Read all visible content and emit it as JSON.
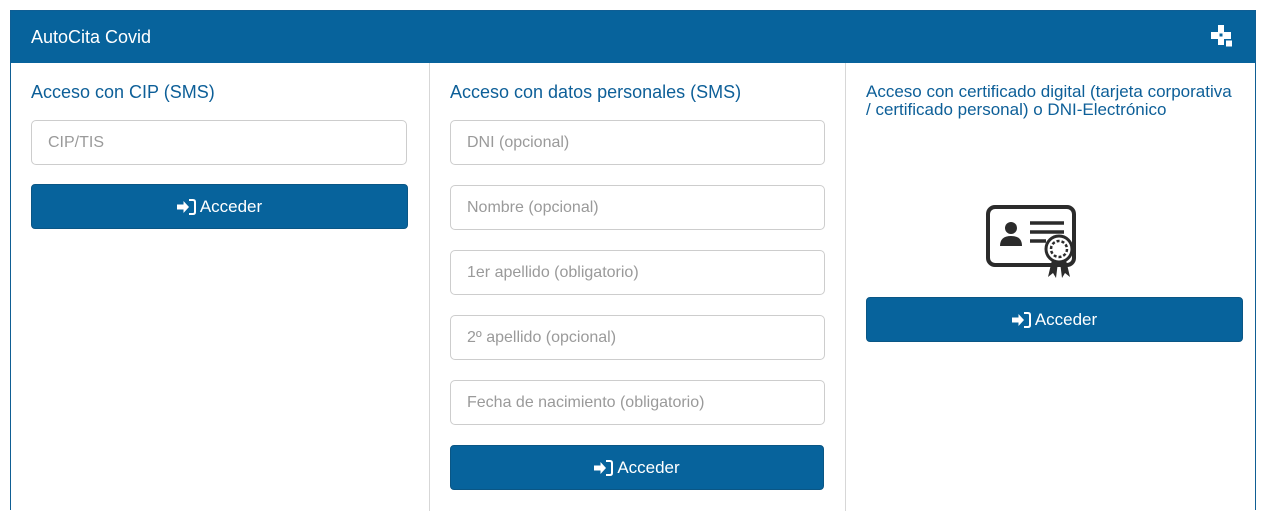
{
  "header": {
    "title": "AutoCita Covid",
    "icon": "health-cross-icon"
  },
  "colors": {
    "primary": "#07639c",
    "title_text": "#0d5f98"
  },
  "cip_section": {
    "title": "Acceso con CIP (SMS)",
    "cip_placeholder": "CIP/TIS",
    "button_label": "Acceder",
    "button_icon": "sign-in-icon"
  },
  "personal_section": {
    "title": "Acceso con datos personales (SMS)",
    "dni_placeholder": "DNI (opcional)",
    "nombre_placeholder": "Nombre (opcional)",
    "apellido1_placeholder": "1er apellido (obligatorio)",
    "apellido2_placeholder": "2º apellido (opcional)",
    "fecha_placeholder": "Fecha de nacimiento (obligatorio)",
    "button_label": "Acceder",
    "button_icon": "sign-in-icon"
  },
  "certificate_section": {
    "title": "Acceso con certificado digital (tarjeta corporativa / certificado personal) o DNI-Electrónico",
    "image_icon": "certificate-icon",
    "button_label": "Acceder",
    "button_icon": "sign-in-icon"
  }
}
